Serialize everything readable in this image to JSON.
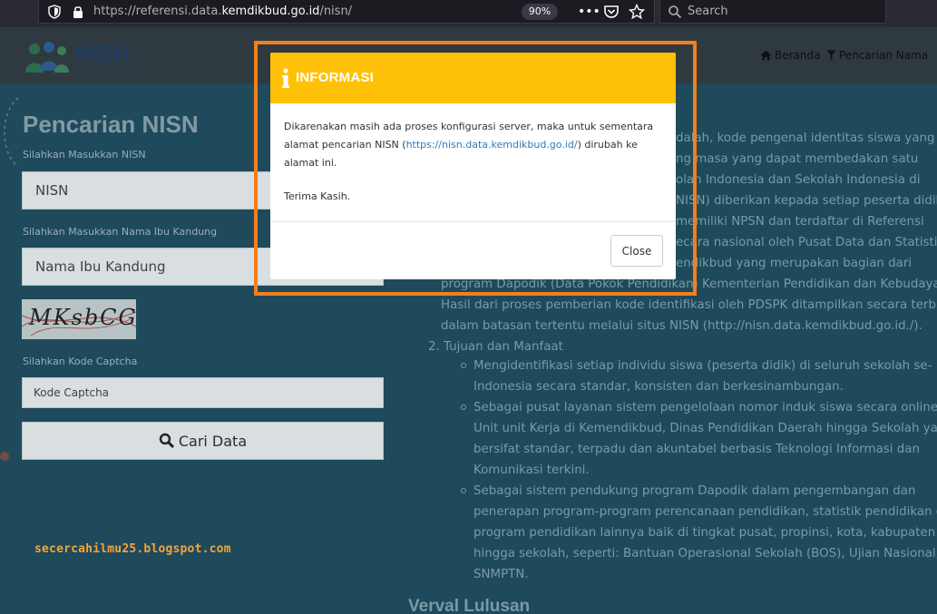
{
  "browser": {
    "url_prefix": "https://referensi.data.",
    "url_host": "kemdikbud.go.id",
    "url_path": "/nisn/",
    "zoom": "90%",
    "search_placeholder": "Search",
    "icons": [
      "shield-icon",
      "lock-icon",
      "more-icon",
      "pocket-icon",
      "star-icon",
      "search-icon"
    ]
  },
  "header": {
    "logo_text": "NISN",
    "logo_subtitle": "NOMOR INDUK SISWA NASIONAL",
    "nav": [
      {
        "label": "Beranda",
        "icon": "home-icon"
      },
      {
        "label": "Pencarian Nama",
        "icon": "filter-icon"
      }
    ]
  },
  "form": {
    "title": "Pencarian NISN",
    "nisn_label": "Silahkan Masukkan NISN",
    "nisn_placeholder": "NISN",
    "mother_label": "Silahkan Masukkan Nama Ibu Kandung",
    "mother_placeholder": "Nama Ibu Kandung",
    "captcha_text": "MKsbCG",
    "captcha_label": "Silahkan Kode Captcha",
    "captcha_placeholder": "Kode Captcha",
    "search_button": "Cari Data"
  },
  "watermark": "secercahilmu25.blogspot.com",
  "content": {
    "line1": "dalah, kode pengenal identitas siswa yang",
    "line2": "ng masa yang dapat membedakan satu",
    "line3": "olah Indonesia dan Sekolah Indonesia di",
    "line4": "NISN) diberikan kepada setiap peserta didik",
    "line5": "memiliki NPSN dan terdaftar di Referensi",
    "line6": "ecara nasional oleh Pusat Data dan Statistik",
    "line7": "endikbud yang merupakan bagian dari",
    "line8": "program Dapodik (Data Pokok Pendidikan) Kementerian Pendidikan dan Kebudayaan.",
    "line9": "Hasil dari proses pemberian kode identifikasi oleh PDSPK ditampilkan secara terbuka",
    "line10": "dalam batasan tertentu melalui situs NISN (http://nisn.data.kemdikbud.go.id./).",
    "section2": "2. Tujuan dan Manfaat",
    "b1l1": "Mengidentifikasi setiap individu siswa (peserta didik) di seluruh sekolah se-",
    "b1l2": "Indonesia secara standar, konsisten dan berkesinambungan.",
    "b2l1": "Sebagai pusat layanan sistem pengelolaan nomor induk siswa secara online bagi",
    "b2l2": "Unit unit Kerja di Kemendikbud, Dinas Pendidikan Daerah hingga Sekolah yang",
    "b2l3": "bersifat standar, terpadu dan akuntabel berbasis Teknologi Informasi dan",
    "b2l4": "Komunikasi terkini.",
    "b3l1": "Sebagai sistem pendukung program Dapodik dalam pengembangan dan",
    "b3l2": "penerapan program-program perencanaan pendidikan, statistik pendidikan dan",
    "b3l3": "program pendidikan lainnya baik di tingkat pusat, propinsi, kota, kabupaten",
    "b3l4": "hingga sekolah, seperti: Bantuan Operasional Sekolah (BOS), Ujian Nasional, PIP,",
    "b3l5": "SNMPTN.",
    "verval": "Verval Lulusan"
  },
  "modal": {
    "icon": "info-icon",
    "title": "INFORMASI",
    "body_before": "Dikarenakan masih ada proses konfigurasi server, maka untuk sementara alamat pencarian NISN (",
    "body_link": "https://nisn.data.kemdikbud.go.id/",
    "body_after": ") dirubah ke alamat ini.",
    "thanks": "Terima Kasih.",
    "close_button": "Close",
    "header_color": "#ffc107",
    "highlight_color": "#f37f1c"
  }
}
